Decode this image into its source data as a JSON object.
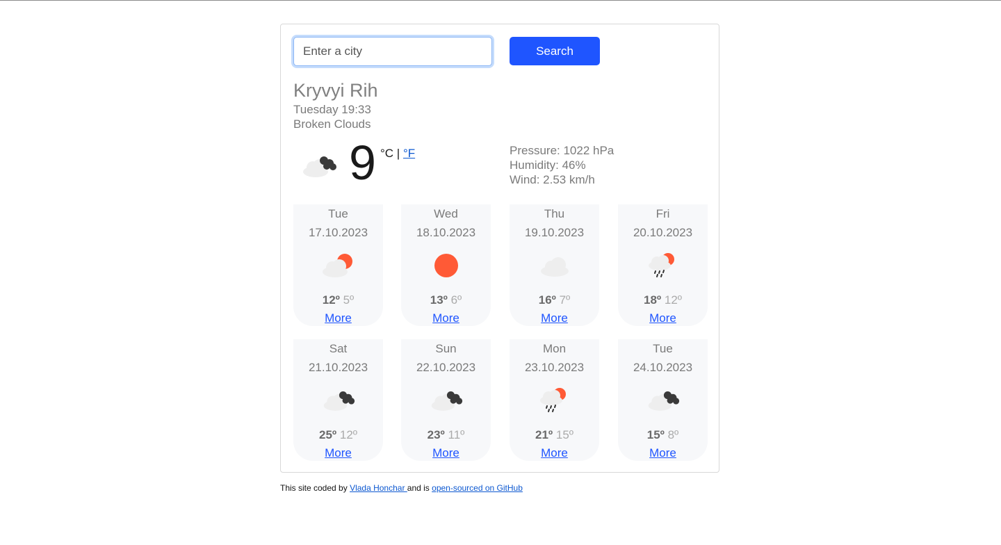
{
  "search": {
    "placeholder": "Enter a city",
    "button_label": "Search"
  },
  "current": {
    "city": "Kryvyi Rih",
    "datetime": "Tuesday 19:33",
    "description": "Broken Clouds",
    "icon": "broken-clouds-icon",
    "temperature": "9",
    "unit_celsius": "°C",
    "unit_separator": " | ",
    "unit_fahrenheit": "°F",
    "pressure": "Pressure: 1022 hPa",
    "humidity": "Humidity: 46%",
    "wind": "Wind: 2.53 km/h"
  },
  "forecast": [
    {
      "weekday": "Tue",
      "date": "17.10.2023",
      "icon": "few-clouds-icon",
      "high": "12º",
      "low": "5º",
      "more": "More"
    },
    {
      "weekday": "Wed",
      "date": "18.10.2023",
      "icon": "clear-sky-icon",
      "high": "13º",
      "low": "6º",
      "more": "More"
    },
    {
      "weekday": "Thu",
      "date": "19.10.2023",
      "icon": "scattered-clouds-icon",
      "high": "16º",
      "low": "7º",
      "more": "More"
    },
    {
      "weekday": "Fri",
      "date": "20.10.2023",
      "icon": "rain-icon",
      "high": "18º",
      "low": "12º",
      "more": "More"
    },
    {
      "weekday": "Sat",
      "date": "21.10.2023",
      "icon": "broken-clouds-icon",
      "high": "25º",
      "low": "12º",
      "more": "More"
    },
    {
      "weekday": "Sun",
      "date": "22.10.2023",
      "icon": "broken-clouds-icon",
      "high": "23º",
      "low": "11º",
      "more": "More"
    },
    {
      "weekday": "Mon",
      "date": "23.10.2023",
      "icon": "rain-icon",
      "high": "21º",
      "low": "15º",
      "more": "More"
    },
    {
      "weekday": "Tue",
      "date": "24.10.2023",
      "icon": "broken-clouds-icon",
      "high": "15º",
      "low": "8º",
      "more": "More"
    }
  ],
  "footer": {
    "prefix": "This site coded by ",
    "author": "Vlada Honchar ",
    "middle": "and is ",
    "repo_link": "open-sourced on GitHub"
  },
  "colors": {
    "accent": "#1f55ff",
    "sun": "#ff5a36",
    "cloud_dark": "#3a3a3a",
    "cloud_light": "#eeeeee"
  }
}
